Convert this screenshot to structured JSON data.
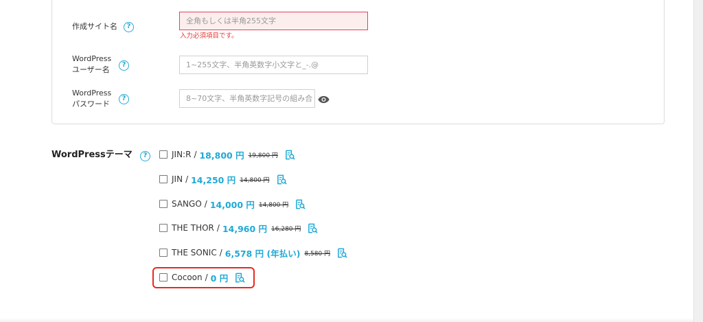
{
  "form": {
    "site_name": {
      "label": "作成サイト名",
      "placeholder": "全角もしくは半角255文字",
      "error": "入力必須項目です。"
    },
    "wp_user": {
      "label_line1": "WordPress",
      "label_line2": "ユーザー名",
      "placeholder": "1~255文字、半角英数字小文字と_-.@"
    },
    "wp_password": {
      "label_line1": "WordPress",
      "label_line2": "パスワード",
      "placeholder": "8~70文字、半角英数字記号の組み合"
    },
    "help_glyph": "?"
  },
  "theme_section": {
    "label": "WordPressテーマ",
    "items": [
      {
        "name": "JIN:R",
        "price": "18,800 円",
        "old_price": "19,800 円"
      },
      {
        "name": "JIN",
        "price": "14,250 円",
        "old_price": "14,800 円"
      },
      {
        "name": "SANGO",
        "price": "14,000 円",
        "old_price": "14,800 円"
      },
      {
        "name": "THE THOR",
        "price": "14,960 円",
        "old_price": "16,280 円"
      },
      {
        "name": "THE SONIC",
        "price": "6,578 円 (年払い)",
        "old_price": "8,580 円"
      },
      {
        "name": "Cocoon",
        "price": "0 円",
        "old_price": ""
      }
    ]
  },
  "colors": {
    "accent": "#1fa9d6",
    "error": "#e53935",
    "highlight": "#e8281f"
  },
  "icons": {
    "help": "help-circle-icon",
    "password_toggle": "eye-icon",
    "theme_preview": "preview-magnifier-icon"
  }
}
